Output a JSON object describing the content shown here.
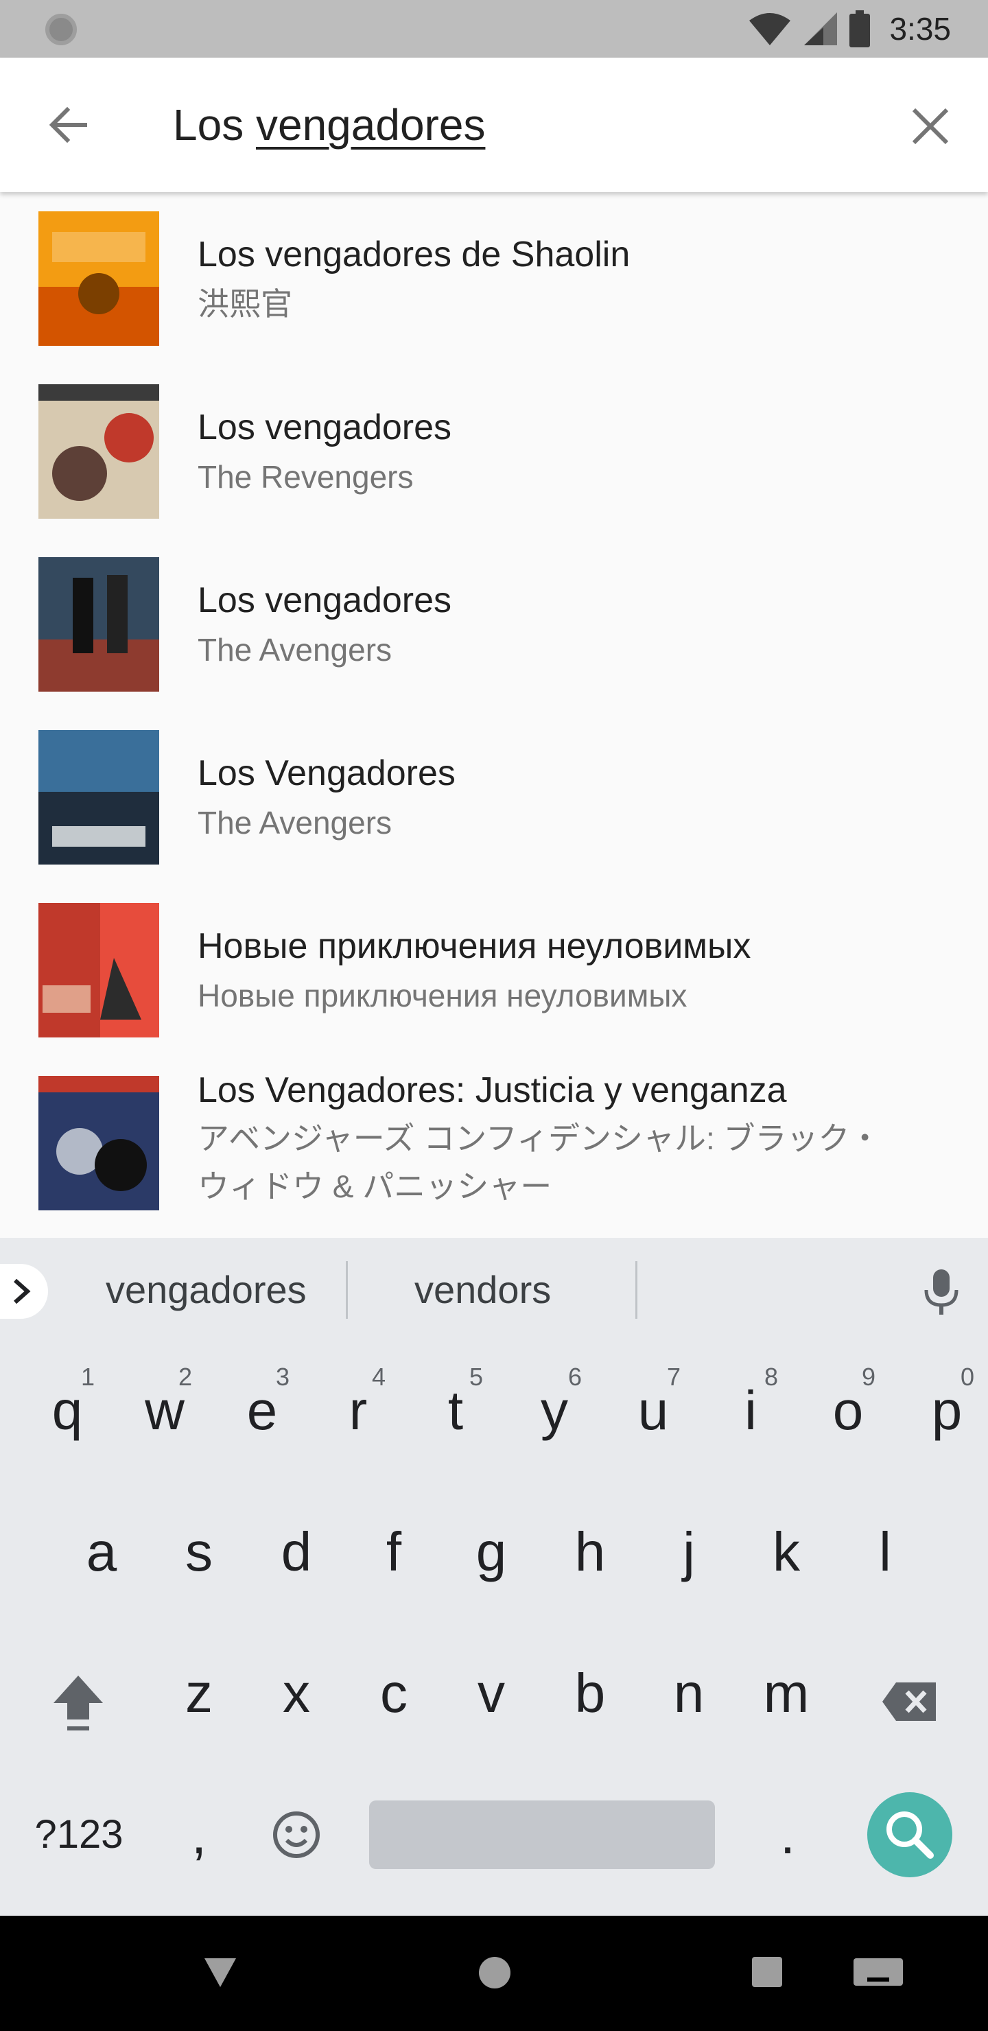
{
  "status": {
    "time": "3:35"
  },
  "search": {
    "query_plain": "Los ",
    "query_underlined": "vengadores"
  },
  "results": [
    {
      "title": "Los vengadores de Shaolin",
      "subtitle": "洪熙官",
      "poster_colors": [
        "#f39c12",
        "#c0392b"
      ]
    },
    {
      "title": "Los vengadores",
      "subtitle": "The Revengers",
      "poster_colors": [
        "#7f8c8d",
        "#a04020"
      ]
    },
    {
      "title": "Los vengadores",
      "subtitle": "The Avengers",
      "poster_colors": [
        "#2c3e50",
        "#8e3b2f"
      ]
    },
    {
      "title": "Los Vengadores",
      "subtitle": "The Avengers",
      "poster_colors": [
        "#1f2d3d",
        "#3a6f9a"
      ]
    },
    {
      "title": "Новые приключения неуловимых",
      "subtitle": "Новые приключения неуловимых",
      "poster_colors": [
        "#e74c3c",
        "#c0392b"
      ]
    },
    {
      "title": "Los Vengadores: Justicia y venganza",
      "subtitle": "アベンジャーズ コンフィデンシャル: ブラック・",
      "subtitle2": "ウィドウ & パニッシャー",
      "poster_colors": [
        "#2b3a67",
        "#c0392b"
      ]
    }
  ],
  "suggestions": {
    "first": "vengadores",
    "second": "vendors"
  },
  "keyboard": {
    "row1": [
      "q",
      "w",
      "e",
      "r",
      "t",
      "y",
      "u",
      "i",
      "o",
      "p"
    ],
    "row1_hints": [
      "1",
      "2",
      "3",
      "4",
      "5",
      "6",
      "7",
      "8",
      "9",
      "0"
    ],
    "row2": [
      "a",
      "s",
      "d",
      "f",
      "g",
      "h",
      "j",
      "k",
      "l"
    ],
    "row3": [
      "z",
      "x",
      "c",
      "v",
      "b",
      "n",
      "m"
    ],
    "symbols_label": "?123",
    "comma": ",",
    "period": "."
  },
  "colors": {
    "accent": "#4db6ac",
    "keyboard_bg": "#e8eaed"
  }
}
